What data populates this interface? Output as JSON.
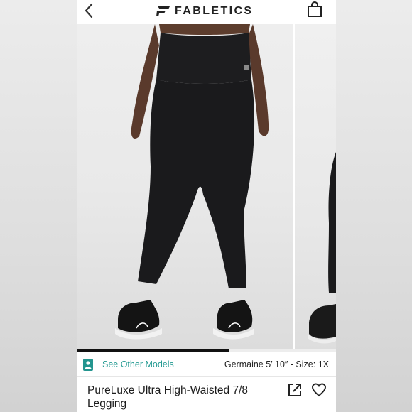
{
  "header": {
    "brand": "FABLETICS",
    "back_icon": "chevron-left-icon",
    "bag_icon": "shopping-bag-icon"
  },
  "gallery": {
    "progress": 0.59
  },
  "model_row": {
    "icon": "person-badge-icon",
    "other_models_label": "See Other Models",
    "model_info": "Germaine 5′ 10″ - Size: 1X"
  },
  "product": {
    "title": "PureLuxe Ultra High-Waisted 7/8 Legging",
    "share_icon": "share-external-icon",
    "favorite_icon": "heart-icon"
  },
  "colors": {
    "accent": "#239a92",
    "text": "#1b1b1b"
  }
}
